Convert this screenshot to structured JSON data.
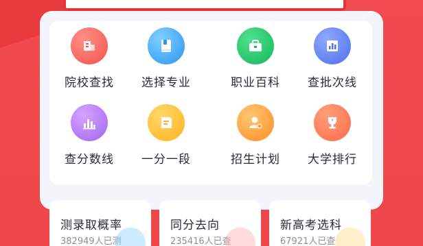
{
  "colors": {
    "background": "#ef474a",
    "card": "#f3f5fa",
    "text": "#2b2b33",
    "subtext": "#8a8f99"
  },
  "grid": {
    "items": [
      {
        "label": "院校查找",
        "icon": "building-icon",
        "color": "#f3534d"
      },
      {
        "label": "选择专业",
        "icon": "book-icon",
        "color": "#2b95f2"
      },
      {
        "label": "职业百科",
        "icon": "toolbox-icon",
        "color": "#15b85a"
      },
      {
        "label": "查批次线",
        "icon": "bar-chart-icon",
        "color": "#4f70ec"
      },
      {
        "label": "查分数线",
        "icon": "column-chart-icon",
        "color": "#a066f2"
      },
      {
        "label": "一分一段",
        "icon": "document-icon",
        "color": "#ffb21f"
      },
      {
        "label": "招生计划",
        "icon": "user-add-icon",
        "color": "#ff8f25"
      },
      {
        "label": "大学排行",
        "icon": "trophy-icon",
        "color": "#ff6a4b"
      }
    ]
  },
  "bottom_cards": [
    {
      "title": "测录取概率",
      "sub": "382949人已测"
    },
    {
      "title": "同分去向",
      "sub": "235416人已查"
    },
    {
      "title": "新高考选科",
      "sub": "67921人已查"
    }
  ]
}
